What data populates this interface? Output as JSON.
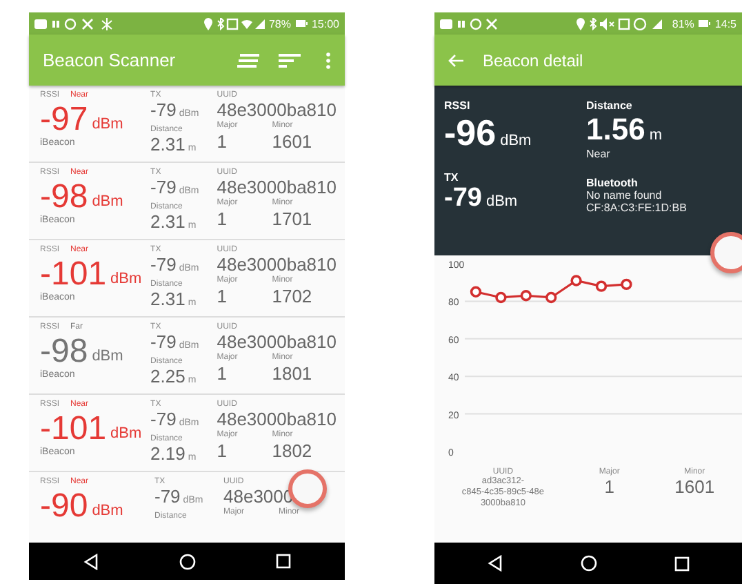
{
  "list_screen": {
    "status_bar": {
      "battery": "78%",
      "time": "15:00"
    },
    "app_bar": {
      "title": "Beacon Scanner"
    },
    "beacons": [
      {
        "rssi_label": "RSSI",
        "proximity": "Near",
        "color": "#e53935",
        "rssi": "-97",
        "rssi_unit": "dBm",
        "type": "iBeacon",
        "tx_label": "TX",
        "tx": "-79",
        "tx_unit": "dBm",
        "distance_label": "Distance",
        "distance": "2.31",
        "distance_unit": "m",
        "uuid_label": "UUID",
        "uuid": "48e3000ba810",
        "major_label": "Major",
        "major": "1",
        "minor_label": "Minor",
        "minor": "1601"
      },
      {
        "rssi_label": "RSSI",
        "proximity": "Near",
        "color": "#e53935",
        "rssi": "-98",
        "rssi_unit": "dBm",
        "type": "iBeacon",
        "tx_label": "TX",
        "tx": "-79",
        "tx_unit": "dBm",
        "distance_label": "Distance",
        "distance": "2.31",
        "distance_unit": "m",
        "uuid_label": "UUID",
        "uuid": "48e3000ba810",
        "major_label": "Major",
        "major": "1",
        "minor_label": "Minor",
        "minor": "1701"
      },
      {
        "rssi_label": "RSSI",
        "proximity": "Near",
        "color": "#e53935",
        "rssi": "-101",
        "rssi_unit": "dBm",
        "type": "iBeacon",
        "tx_label": "TX",
        "tx": "-79",
        "tx_unit": "dBm",
        "distance_label": "Distance",
        "distance": "2.31",
        "distance_unit": "m",
        "uuid_label": "UUID",
        "uuid": "48e3000ba810",
        "major_label": "Major",
        "major": "1",
        "minor_label": "Minor",
        "minor": "1702"
      },
      {
        "rssi_label": "RSSI",
        "proximity": "Far",
        "color": "#757575",
        "rssi": "-98",
        "rssi_unit": "dBm",
        "type": "iBeacon",
        "tx_label": "TX",
        "tx": "-79",
        "tx_unit": "dBm",
        "distance_label": "Distance",
        "distance": "2.25",
        "distance_unit": "m",
        "uuid_label": "UUID",
        "uuid": "48e3000ba810",
        "major_label": "Major",
        "major": "1",
        "minor_label": "Minor",
        "minor": "1801"
      },
      {
        "rssi_label": "RSSI",
        "proximity": "Near",
        "color": "#e53935",
        "rssi": "-101",
        "rssi_unit": "dBm",
        "type": "iBeacon",
        "tx_label": "TX",
        "tx": "-79",
        "tx_unit": "dBm",
        "distance_label": "Distance",
        "distance": "2.19",
        "distance_unit": "m",
        "uuid_label": "UUID",
        "uuid": "48e3000ba810",
        "major_label": "Major",
        "major": "1",
        "minor_label": "Minor",
        "minor": "1802"
      },
      {
        "rssi_label": "RSSI",
        "proximity": "Near",
        "color": "#e53935",
        "rssi": "-90",
        "rssi_unit": "dBm",
        "tx_label": "TX",
        "tx": "-79",
        "tx_unit": "dBm",
        "distance_label": "Distance",
        "uuid_label": "UUID",
        "uuid": "48e3000",
        "major_label": "Major",
        "minor_label": "Minor"
      }
    ]
  },
  "detail_screen": {
    "status_bar": {
      "battery": "81%",
      "time": "14:5"
    },
    "app_bar": {
      "title": "Beacon detail"
    },
    "rssi_label": "RSSI",
    "rssi": "-96",
    "rssi_unit": "dBm",
    "distance_label": "Distance",
    "distance": "1.56",
    "distance_unit": "m",
    "proximity": "Near",
    "tx_label": "TX",
    "tx": "-79",
    "tx_unit": "dBm",
    "bluetooth_label": "Bluetooth",
    "bluetooth_name": "No name found",
    "bluetooth_address": "CF:8A:C3:FE:1D:BB",
    "chart_data": {
      "type": "line",
      "grid": true,
      "ylim": [
        0,
        100
      ],
      "yticks": [
        {
          "value": 0,
          "label": "0"
        },
        {
          "value": 20,
          "label": "20"
        },
        {
          "value": 40,
          "label": "40"
        },
        {
          "value": 60,
          "label": "60"
        },
        {
          "value": 80,
          "label": "80"
        },
        {
          "value": 100,
          "label": "100"
        }
      ],
      "series": [
        {
          "color": "#d32f2f",
          "marker": "circle",
          "values": [
            85,
            82,
            83,
            82,
            91,
            88,
            89
          ]
        }
      ]
    },
    "uuid_label": "UUID",
    "uuid_lines": [
      "ad3ac312-",
      "c845-4c35-89c5-48e",
      "3000ba810"
    ],
    "major_label": "Major",
    "major": "1",
    "minor_label": "Minor",
    "minor": "1601"
  }
}
